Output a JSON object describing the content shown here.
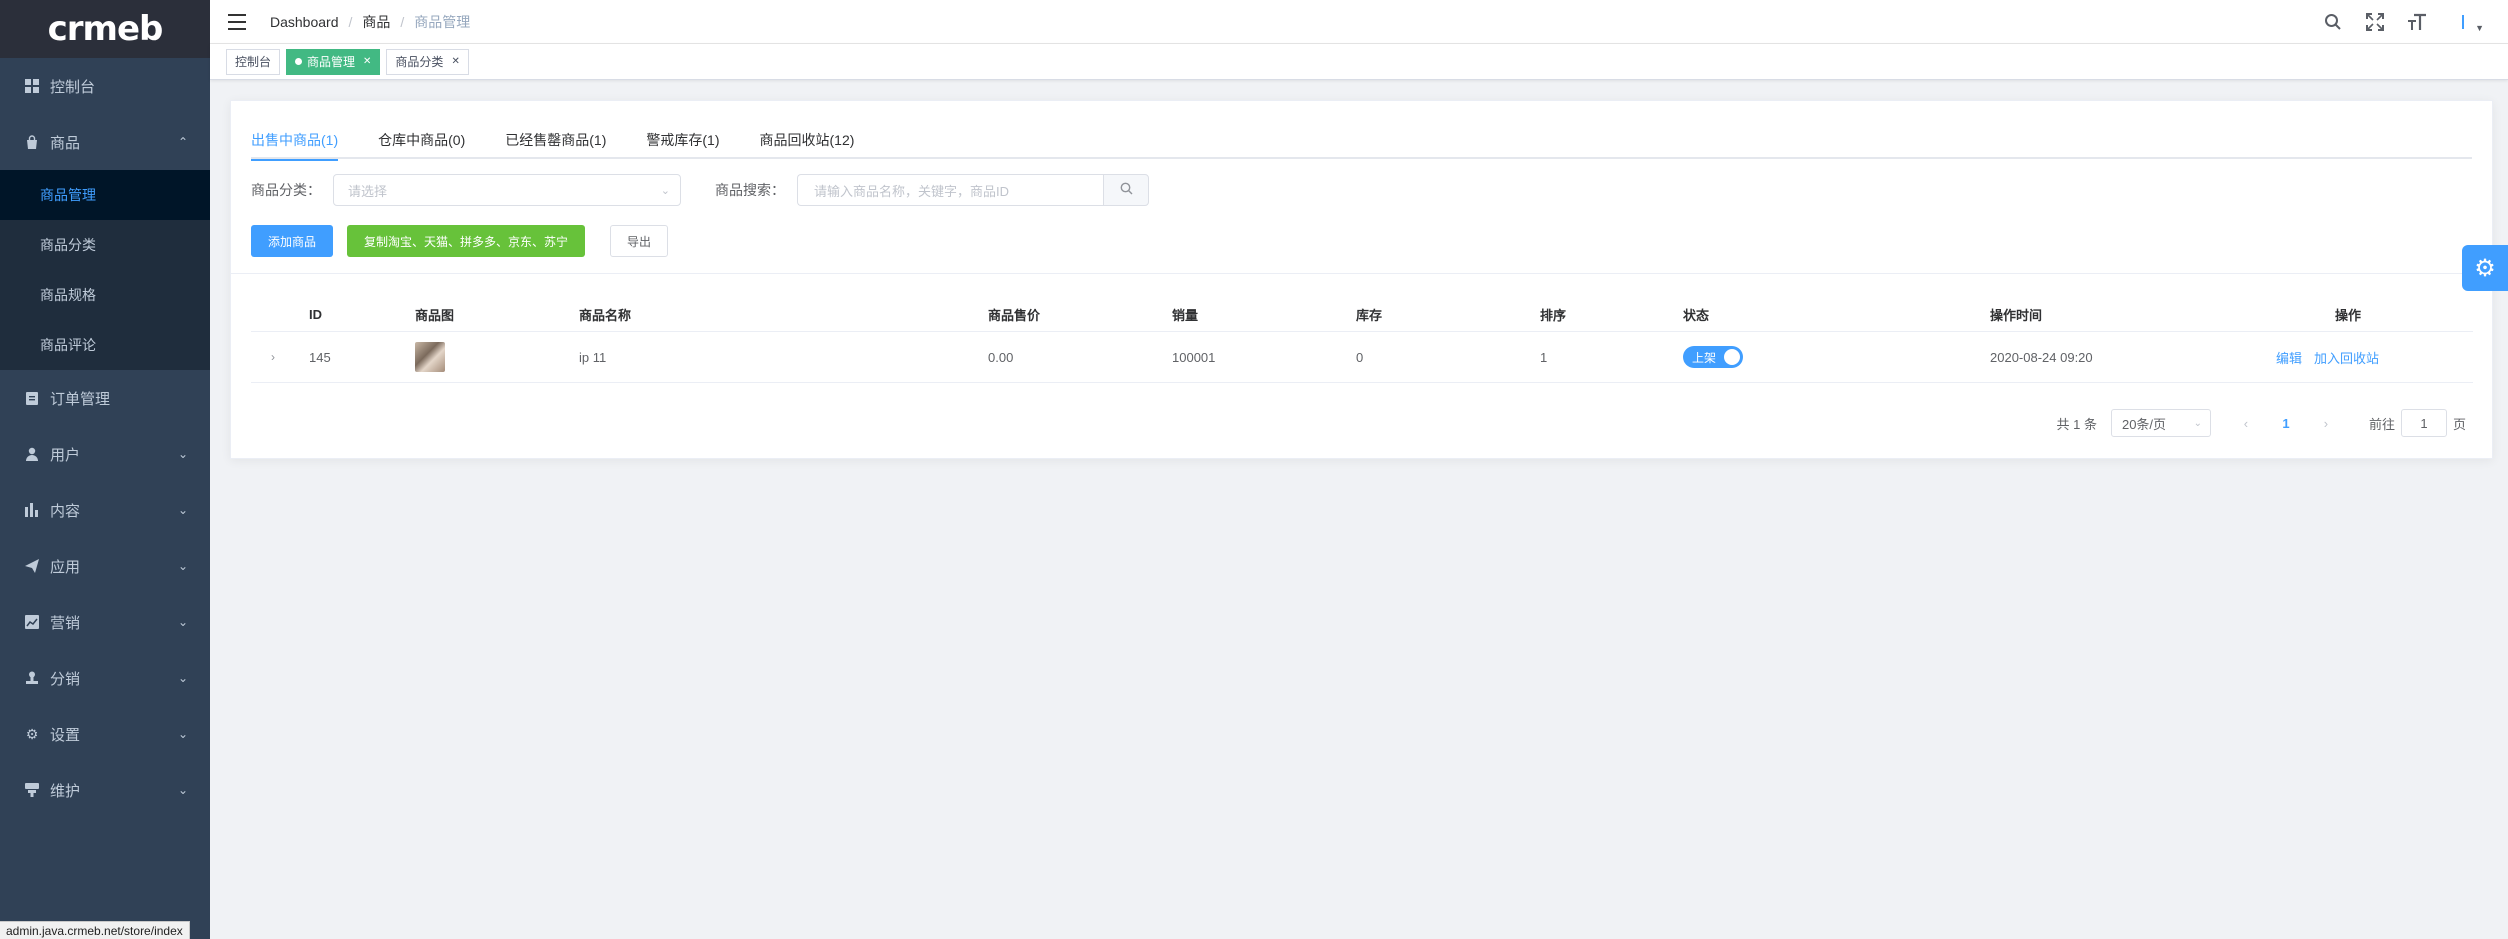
{
  "logo": "crmeb",
  "sidebar": {
    "items": [
      {
        "label": "控制台",
        "icon": "dashboard-icon"
      },
      {
        "label": "商品",
        "icon": "shopping-bag-icon",
        "expanded": true,
        "children": [
          {
            "label": "商品管理",
            "active": true
          },
          {
            "label": "商品分类"
          },
          {
            "label": "商品规格"
          },
          {
            "label": "商品评论"
          }
        ]
      },
      {
        "label": "订单管理",
        "icon": "clipboard-icon"
      },
      {
        "label": "用户",
        "icon": "user-icon"
      },
      {
        "label": "内容",
        "icon": "bar-chart-icon"
      },
      {
        "label": "应用",
        "icon": "send-icon"
      },
      {
        "label": "营销",
        "icon": "chart-icon"
      },
      {
        "label": "分销",
        "icon": "stamp-icon"
      },
      {
        "label": "设置",
        "icon": "gear-icon"
      },
      {
        "label": "维护",
        "icon": "maintenance-icon"
      }
    ]
  },
  "header": {
    "breadcrumb": [
      "Dashboard",
      "商品",
      "商品管理"
    ]
  },
  "tags": [
    {
      "label": "控制台",
      "active": false,
      "closable": false
    },
    {
      "label": "商品管理",
      "active": true,
      "closable": true
    },
    {
      "label": "商品分类",
      "active": false,
      "closable": true
    }
  ],
  "tabs": [
    "出售中商品(1)",
    "仓库中商品(0)",
    "已经售罄商品(1)",
    "警戒库存(1)",
    "商品回收站(12)"
  ],
  "filters": {
    "category_label": "商品分类：",
    "category_placeholder": "请选择",
    "search_label": "商品搜索：",
    "search_placeholder": "请输入商品名称，关键字，商品ID"
  },
  "buttons": {
    "add": "添加商品",
    "copy": "复制淘宝、天猫、拼多多、京东、苏宁",
    "export": "导出"
  },
  "table": {
    "columns": [
      "ID",
      "商品图",
      "商品名称",
      "商品售价",
      "销量",
      "库存",
      "排序",
      "状态",
      "操作时间",
      "操作"
    ],
    "rows": [
      {
        "id": "145",
        "name": "ip 11",
        "price": "0.00",
        "sales": "100001",
        "stock": "0",
        "sort": "1",
        "status": "上架",
        "time": "2020-08-24 09:20",
        "actions": [
          "编辑",
          "加入回收站"
        ]
      }
    ]
  },
  "pagination": {
    "total": "共 1 条",
    "page_size": "20条/页",
    "current": "1",
    "goto_prefix": "前往",
    "goto_value": "1",
    "goto_suffix": "页"
  },
  "statusbar": "admin.java.crmeb.net/store/index",
  "colors": {
    "primary": "#409eff",
    "success": "#67c23a",
    "sidebar": "#304156",
    "tag_active": "#42b983"
  }
}
